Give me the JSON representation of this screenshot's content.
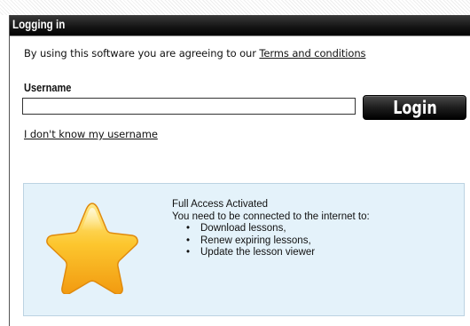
{
  "window": {
    "title": "Logging in"
  },
  "terms": {
    "prefix": "By using this software you are agreeing to our ",
    "link_label": "Terms and conditions"
  },
  "login": {
    "username_label": "Username",
    "username_value": "",
    "username_placeholder": "",
    "button_label": "Login",
    "forgot_label": "I don't know my username"
  },
  "status": {
    "icon": "star-icon",
    "title": "Full Access Activated",
    "message": "You need to be connected to the internet to:",
    "items": [
      "Download lessons,",
      "Renew expiring lessons,",
      "Update the lesson viewer"
    ],
    "bullet": "•"
  },
  "colors": {
    "header_bg": "#000000",
    "button_bg": "#1e1e1e",
    "info_bg": "#e4f2fa",
    "info_border": "#bcd3e2",
    "star_fill": "#f7b21c"
  }
}
